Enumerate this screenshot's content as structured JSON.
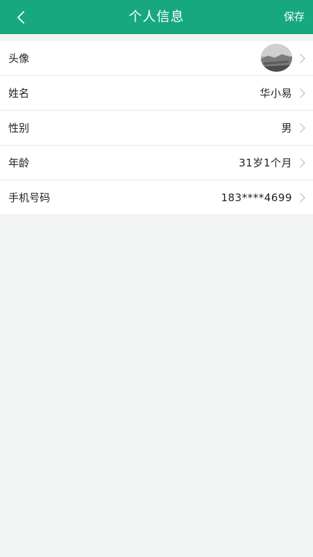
{
  "header": {
    "title": "个人信息",
    "save_label": "保存",
    "back_icon": "chevron-left-icon"
  },
  "colors": {
    "header_bg": "#17a87f",
    "page_bg": "#f2f4f3"
  },
  "profile": {
    "rows": [
      {
        "label": "头像",
        "value": ""
      },
      {
        "label": "姓名",
        "value": "华小易"
      },
      {
        "label": "性别",
        "value": "男"
      },
      {
        "label": "年龄",
        "value": "31岁1个月"
      },
      {
        "label": "手机号码",
        "value": "183****4699"
      }
    ]
  }
}
